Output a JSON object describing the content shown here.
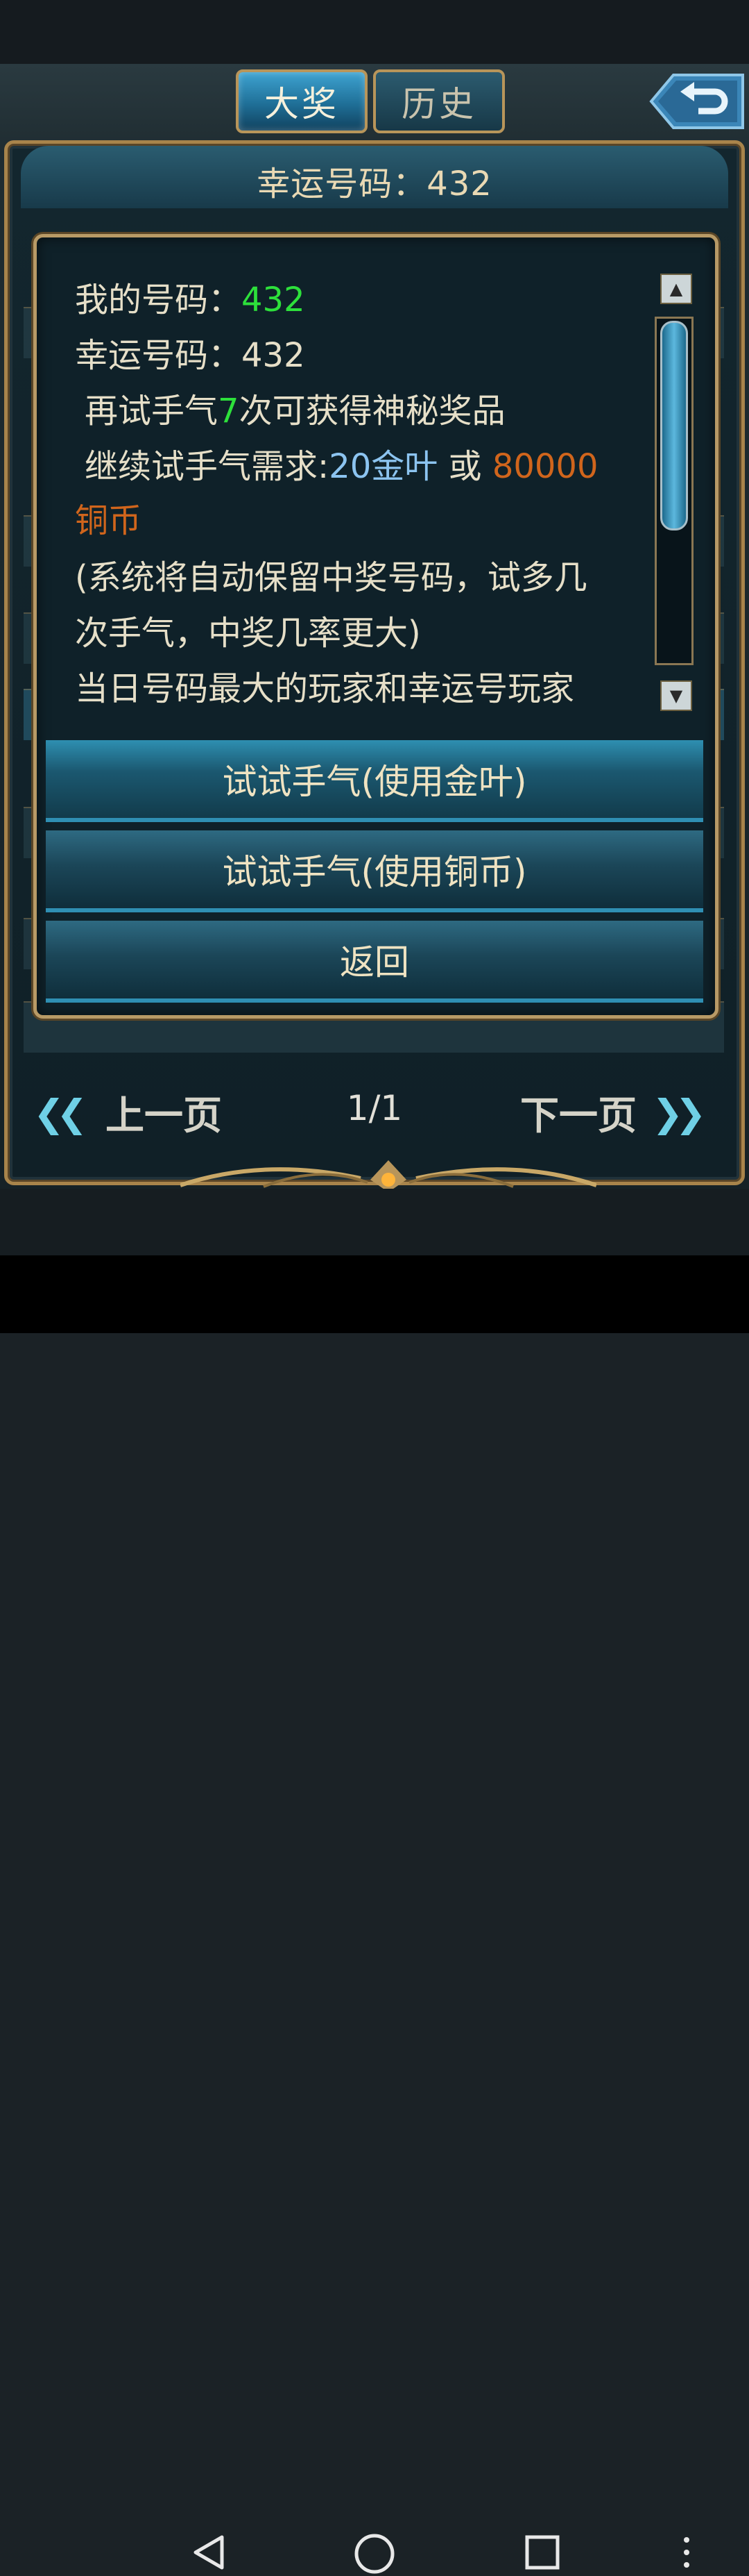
{
  "tabs": {
    "jackpot": "大奖",
    "history": "历史"
  },
  "header": {
    "lucky_number_line": "幸运号码：432"
  },
  "info": {
    "my_number_label": "我的号码：",
    "my_number_value": "432",
    "lucky_number_label": "幸运号码：",
    "lucky_number_value": "432",
    "retry_prefix": "再试手气",
    "retry_count": "7",
    "retry_suffix": "次可获得神秘奖品",
    "continue_prefix": "继续试手气需求:",
    "gold_cost": "20金叶",
    "or_text": " 或 ",
    "coin_cost": "80000",
    "coin_unit": "铜币",
    "note_line1": "(系统将自动保留中奖号码，试多几",
    "note_line2": "次手气，中奖几率更大)",
    "partial_line": "当日号码最大的玩家和幸运号玩家"
  },
  "buttons": {
    "try_gold": "试试手气(使用金叶)",
    "try_coin": "试试手气(使用铜币)",
    "back": "返回"
  },
  "pagination": {
    "prev": "上一页",
    "next": "下一页",
    "page": "1/1"
  },
  "colors": {
    "accent_green": "#2de03b",
    "cost_blue": "#8cc4f0",
    "coin_orange": "#d0651c",
    "gold_frame": "#b8955a"
  }
}
